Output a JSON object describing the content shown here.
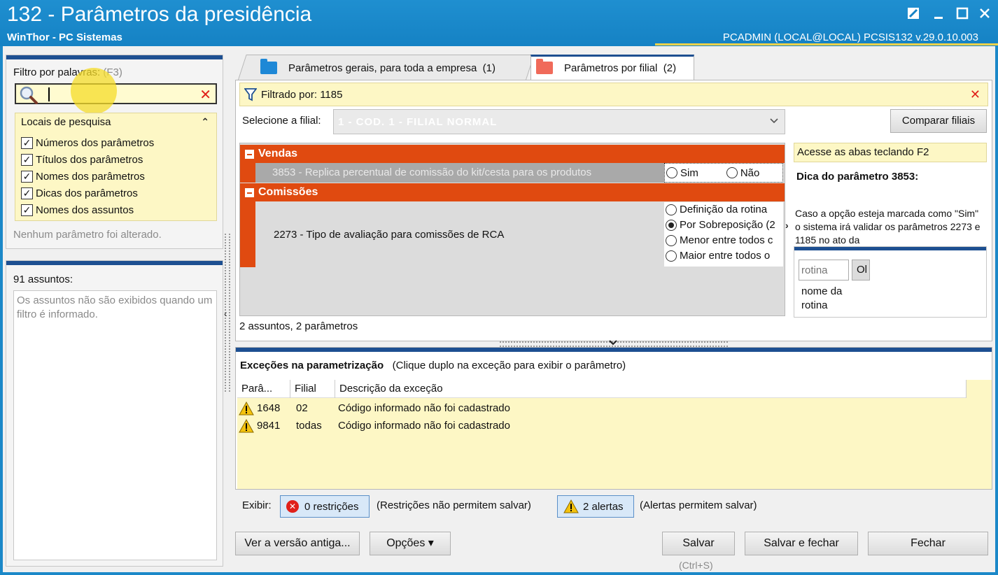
{
  "window": {
    "title": "132 - Parâmetros da presidência",
    "subtitle": "WinThor - PC Sistemas",
    "user_info": "PCADMIN (LOCAL@LOCAL)   PCSIS132  v.29.0.10.003"
  },
  "filter": {
    "label": "Filtro por palavras:",
    "hint": "(F3)",
    "value": "",
    "locais_title": "Locais de pesquisa",
    "options": [
      {
        "label": "Números dos parâmetros",
        "checked": true
      },
      {
        "label": "Títulos dos parâmetros",
        "checked": true
      },
      {
        "label": "Nomes dos parâmetros",
        "checked": true
      },
      {
        "label": "Dicas dos parâmetros",
        "checked": true
      },
      {
        "label": "Nomes dos assuntos",
        "checked": true
      }
    ],
    "status": "Nenhum parâmetro foi alterado."
  },
  "assuntos": {
    "count_label": "91 assuntos:",
    "message": "Os assuntos não são exibidos quando um filtro é informado."
  },
  "tabs": [
    {
      "label": "Parâmetros gerais, para toda a empresa",
      "count": "(1)",
      "color": "#1e88d6"
    },
    {
      "label": "Parâmetros por filial",
      "count": "(2)",
      "color": "#f06a5a"
    }
  ],
  "filtered": {
    "text": "Filtrado por: 1185"
  },
  "filial": {
    "label": "Selecione a filial:",
    "value": "1 - COD. 1 - FILIAL NORMAL",
    "compare_button": "Comparar filiais"
  },
  "groups": [
    {
      "name": "Vendas",
      "param": "3853 - Replica percentual de comissão do kit/cesta para os produtos",
      "options": [
        "Sim",
        "Não"
      ]
    },
    {
      "name": "Comissões",
      "param": "2273 - Tipo de avaliação para comissões de RCA",
      "options": [
        "Definição da rotina",
        "Por Sobreposição (2",
        "Menor entre todos c",
        "Maior entre todos o"
      ],
      "selected": 1
    }
  ],
  "summary": "2 assuntos, 2 parâmetros",
  "tip": {
    "shortcut": "Acesse as abas teclando F2",
    "title": "Dica do parâmetro 3853:",
    "body": "Caso a opção esteja marcada como \"Sim\" o sistema irá validar os parâmetros 2273 e 1185 no ato da",
    "rotina_placeholder": "rotina",
    "rotina_button": "Ol",
    "rotina_label": "nome da rotina"
  },
  "exceptions": {
    "title": "Exceções na parametrização",
    "subtitle": "(Clique duplo na exceção para exibir o parâmetro)",
    "columns": [
      "Parâ...",
      "Filial",
      "Descrição da exceção"
    ],
    "rows": [
      {
        "param": "1648",
        "filial": "02",
        "desc": "Código informado não foi cadastrado"
      },
      {
        "param": "9841",
        "filial": "todas",
        "desc": "Código informado não foi cadastrado"
      }
    ],
    "exibir_label": "Exibir:",
    "restricoes_button": "0 restrições",
    "restricoes_note": "(Restrições não permitem salvar)",
    "alertas_button": "2 alertas",
    "alertas_note": "(Alertas permitem salvar)"
  },
  "buttons": {
    "versao": "Ver a versão antiga...",
    "opcoes": "Opções ▾",
    "salvar": "Salvar",
    "salvar_hint": "(Ctrl+S)",
    "salvar_fechar": "Salvar e fechar",
    "fechar": "Fechar"
  }
}
